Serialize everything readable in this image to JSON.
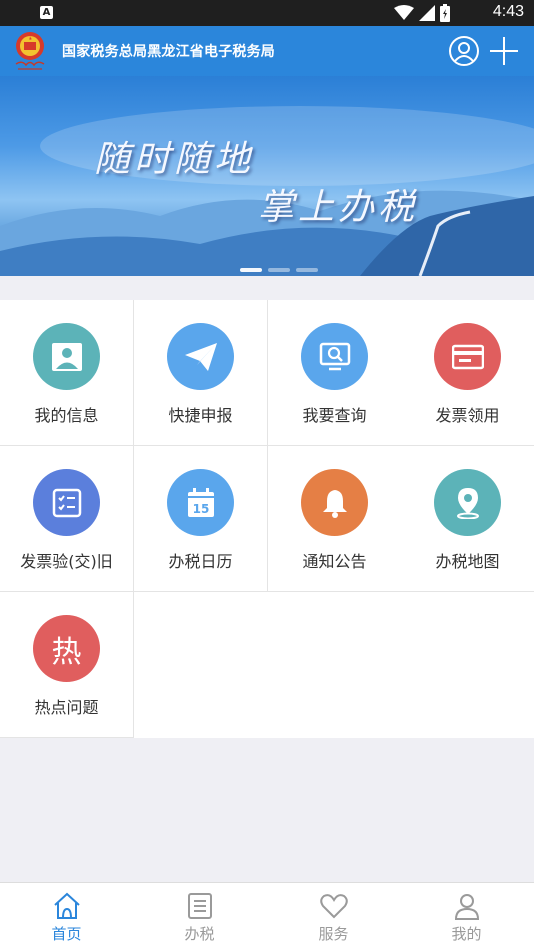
{
  "status_bar": {
    "notification_icon": "A",
    "time": "4:43",
    "icons": [
      "wifi-icon",
      "signal-icon",
      "battery-icon"
    ]
  },
  "header": {
    "title": "国家税务总局黑龙江省电子税务局",
    "icons": [
      "emblem-logo",
      "user-icon",
      "plus-icon"
    ]
  },
  "banner": {
    "line1": "随时随地",
    "line2": "掌上办税",
    "slide_count": 3,
    "active_slide": 1
  },
  "menu": [
    {
      "label": "我的信息",
      "icon": "profile-icon",
      "color": "#5cb3b8"
    },
    {
      "label": "快捷申报",
      "icon": "paper-plane-icon",
      "color": "#5aa6ec"
    },
    {
      "label": "我要查询",
      "icon": "search-monitor-icon",
      "color": "#5aa6ec"
    },
    {
      "label": "发票领用",
      "icon": "invoice-card-icon",
      "color": "#e05e5e"
    },
    {
      "label": "发票验(交)旧",
      "icon": "checklist-icon",
      "color": "#5b7fdc"
    },
    {
      "label": "办税日历",
      "icon": "calendar-icon",
      "color": "#5aa6ec"
    },
    {
      "label": "通知公告",
      "icon": "bell-icon",
      "color": "#e57f45"
    },
    {
      "label": "办税地图",
      "icon": "map-pin-icon",
      "color": "#5cb3b8"
    },
    {
      "label": "热点问题",
      "icon": "hot-icon",
      "color": "#e05e5e",
      "glyph": "热"
    }
  ],
  "calendar_day": "15",
  "tabbar": [
    {
      "label": "首页",
      "icon": "home-icon",
      "active": true
    },
    {
      "label": "办税",
      "icon": "list-icon",
      "active": false
    },
    {
      "label": "服务",
      "icon": "heart-icon",
      "active": false
    },
    {
      "label": "我的",
      "icon": "person-icon",
      "active": false
    }
  ],
  "colors": {
    "primary": "#2b86db",
    "tab_inactive": "#9a9a9a"
  }
}
